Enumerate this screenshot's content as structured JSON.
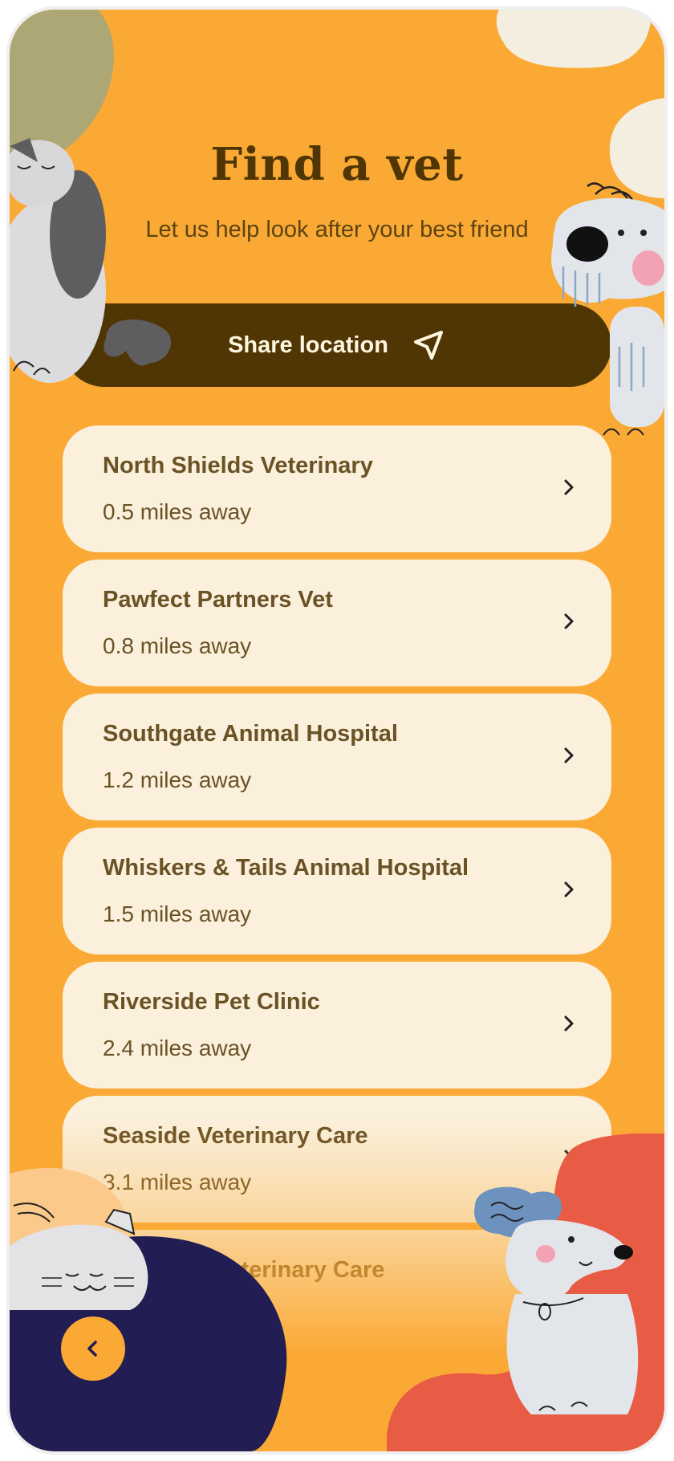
{
  "header": {
    "title": "Find a vet",
    "subtitle": "Let us help look after your best friend"
  },
  "share_button": {
    "label": "Share location",
    "icon": "navigation-arrow-icon"
  },
  "vets": [
    {
      "name": "North Shields Veterinary",
      "distance": "0.5 miles away"
    },
    {
      "name": "Pawfect Partners Vet",
      "distance": "0.8 miles away"
    },
    {
      "name": "Southgate Animal Hospital",
      "distance": "1.2 miles away"
    },
    {
      "name": "Whiskers & Tails Animal Hospital",
      "distance": "1.5 miles away"
    },
    {
      "name": "Riverside Pet Clinic",
      "distance": "2.4 miles away"
    },
    {
      "name": "Seaside Veterinary Care",
      "distance": "3.1 miles away"
    },
    {
      "name": "Oakwood Veterinary Care",
      "distance": ""
    }
  ],
  "back_button": {
    "icon": "chevron-left-icon"
  },
  "colors": {
    "background": "#FBA935",
    "accent_dark": "#4F3604",
    "card": "#FAF0DC",
    "navy_blob": "#221D52",
    "red_blob": "#E85C45",
    "olive_blob": "#ADA775",
    "cream_blob": "#F3EEDF"
  }
}
